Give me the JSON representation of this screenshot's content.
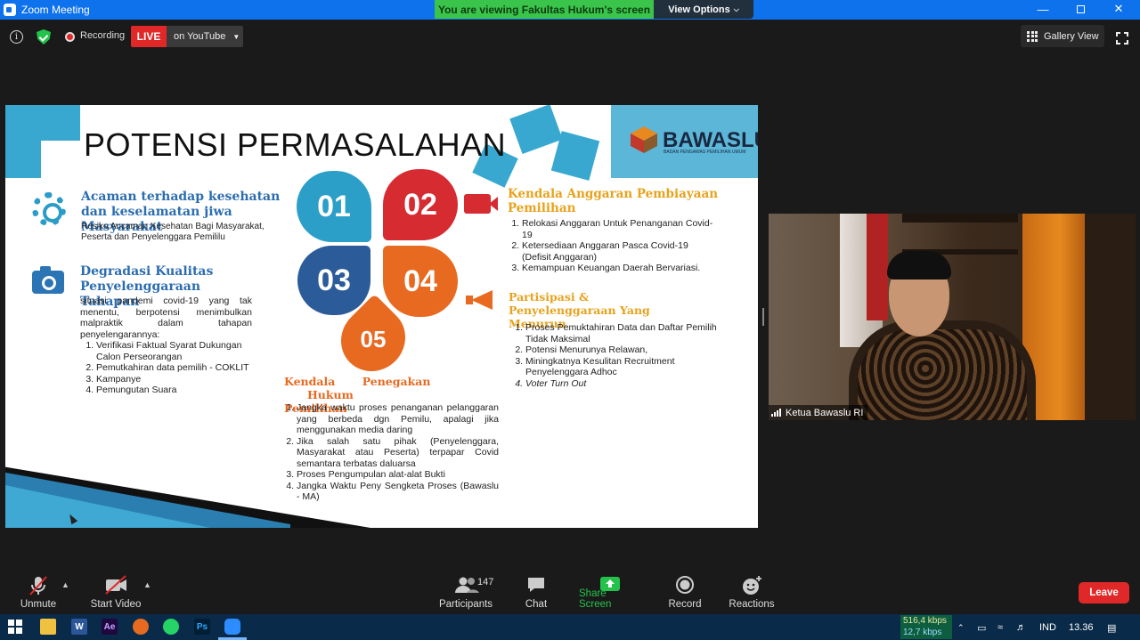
{
  "titlebar": {
    "title": "Zoom Meeting",
    "viewing_banner": "You are viewing Fakultas Hukum's screen",
    "view_options": "View Options",
    "minimize_icon": "minimize-icon",
    "maximize_icon": "restore-icon",
    "close_icon": "close-icon"
  },
  "infobar": {
    "recording_label": "Recording",
    "live_label": "LIVE",
    "youtube_label": "on YouTube",
    "gallery_view_label": "Gallery View"
  },
  "slide": {
    "title": "POTENSI PERMASALAHAN",
    "logo_text": "BAWASLU",
    "logo_subtext": "BADAN PENGAWAS PEMILIHAN UMUM",
    "petals": [
      {
        "number": "01",
        "color": "#2c9fc8"
      },
      {
        "number": "02",
        "color": "#d72b32"
      },
      {
        "number": "03",
        "color": "#2c5b99"
      },
      {
        "number": "04",
        "color": "#e86a21"
      },
      {
        "number": "05",
        "color": "#e86a21"
      }
    ],
    "section1": {
      "title": "Acaman terhadap kesehatan dan keselamatan jiwa Masyarakat",
      "subtitle": "Resiko Ancaman Kesehatan Bagi Masyarakat, Peserta dan Penyelenggara Pemililu",
      "color": "#2b6db0"
    },
    "section3": {
      "title": "Degradasi Kualitas Penyelenggaraan Tahapan",
      "intro": "situasi pandemi covid-19 yang tak menentu, berpotensi menimbulkan malpraktik dalam tahapan penyelengarannya:",
      "items": [
        "Verifikasi Faktual Syarat Dukungan Calon Perseorangan",
        "Pemutkahiran data pemilih - COKLIT",
        "Kampanye",
        "Pemungutan Suara"
      ],
      "color": "#2b6db0"
    },
    "section2": {
      "title": "Kendala Anggaran Pembiayaan Pemilihan",
      "items": [
        "Relokasi Anggaran Untuk Penanganan Covid-19",
        "Ketersediaan Anggaran Pasca Covid-19 (Defisit Anggaran)",
        "Kemampuan Keuangan Daerah Bervariasi."
      ],
      "color": "#e8a21c"
    },
    "section4": {
      "title": "Partisipasi & Penyelenggaraan Yang Menurun",
      "items": [
        "Proses Pemuktahiran Data dan Daftar Pemilih Tidak Maksimal",
        "Potensi Menurunya Relawan,",
        "Miningkatnya Kesulitan Recruitment Penyelenggara Adhoc",
        "Voter Turn Out"
      ],
      "color": "#e8a21c"
    },
    "section5": {
      "title_part1": "Kendala",
      "title_part2": "Penegakan",
      "title_part3": "Hukum",
      "title_part4": "Pemilihan",
      "items": [
        "Jangka waktu proses penanganan pelanggaran yang berbeda dgn Pemilu, apalagi jika menggunakan media daring",
        "Jika salah satu pihak (Penyelenggara, Masyarakat atau Peserta) terpapar Covid semantara terbatas daluarsa",
        "Proses Pengumpulan alat-alat Bukti",
        "Jangka Waktu Peny Sengketa Proses (Bawaslu - MA)"
      ],
      "color": "#e86a21"
    }
  },
  "video": {
    "participant_name": "Ketua Bawaslu RI"
  },
  "toolbar": {
    "unmute": "Unmute",
    "start_video": "Start Video",
    "participants": "Participants",
    "participants_count": "147",
    "chat": "Chat",
    "share_screen": "Share Screen",
    "record": "Record",
    "reactions": "Reactions",
    "leave": "Leave",
    "share_color": "#23c34b"
  },
  "taskbar": {
    "apps": [
      "windows-start-icon",
      "file-explorer-icon",
      "word-icon",
      "after-effects-icon",
      "firefox-icon",
      "whatsapp-icon",
      "photoshop-icon",
      "zoom-icon"
    ],
    "net_down": "516,4 kbps",
    "net_up": "12,7 kbps",
    "language": "IND",
    "time": "13.36"
  }
}
